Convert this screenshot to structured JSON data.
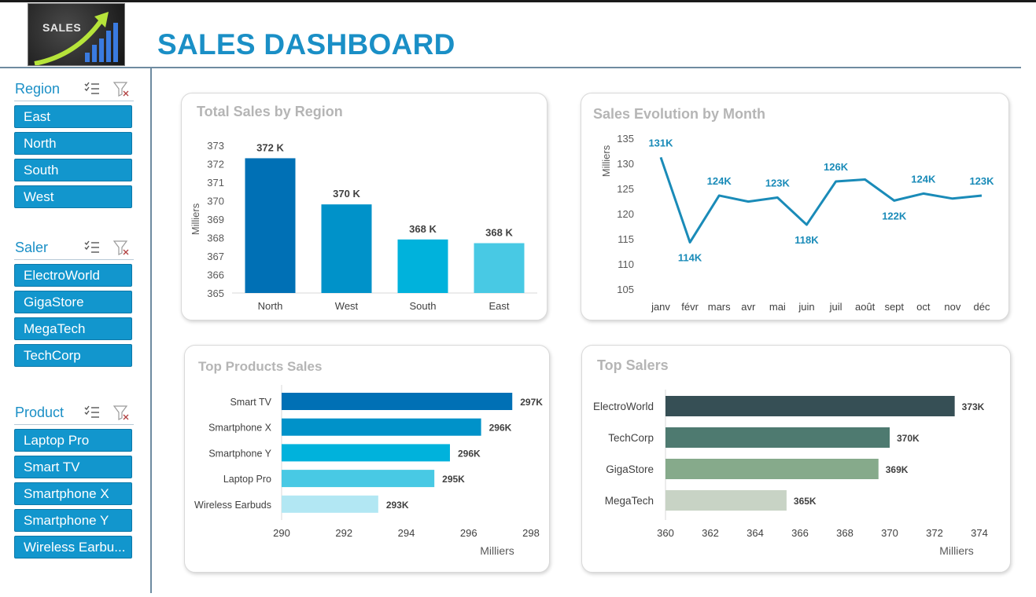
{
  "header": {
    "logo_text": "SALES",
    "title": "SALES DASHBOARD"
  },
  "slicers": {
    "region": {
      "title": "Region",
      "items": [
        "East",
        "North",
        "South",
        "West"
      ]
    },
    "saler": {
      "title": "Saler",
      "items": [
        "ElectroWorld",
        "GigaStore",
        "MegaTech",
        "TechCorp"
      ]
    },
    "product": {
      "title": "Product",
      "items": [
        "Laptop Pro",
        "Smart TV",
        "Smartphone X",
        "Smartphone Y",
        "Wireless Earbu..."
      ]
    }
  },
  "icons": {
    "multiselect": "multi-select-icon",
    "clear_filter": "clear-filter-icon"
  },
  "colors": {
    "accent": "#1a8fc6",
    "slicer_item": "#1296cd",
    "region_bars": [
      "#0070b5",
      "#0092c9",
      "#00b2dc",
      "#48c9e4"
    ],
    "line": "#1a8bb8",
    "product_bars": [
      "#0070b5",
      "#0092c9",
      "#00b2dc",
      "#48c9e4",
      "#b2e7f3"
    ],
    "saler_bars": [
      "#364f55",
      "#4e7a70",
      "#86aa8b",
      "#c8d3c5"
    ]
  },
  "chart_data": [
    {
      "id": "region",
      "type": "bar",
      "title": "Total Sales by Region",
      "ylabel": "Milliers",
      "categories": [
        "North",
        "West",
        "South",
        "East"
      ],
      "values": [
        372.3,
        369.8,
        367.9,
        367.7
      ],
      "data_labels": [
        "372 K",
        "370 K",
        "368 K",
        "368 K"
      ],
      "yticks": [
        365,
        366,
        367,
        368,
        369,
        370,
        371,
        372,
        373
      ],
      "ylim": [
        365,
        373
      ],
      "grid": false
    },
    {
      "id": "month",
      "type": "line",
      "title": "Sales Evolution by Month",
      "ylabel": "Milliers",
      "categories": [
        "janv",
        "févr",
        "mars",
        "avr",
        "mai",
        "juin",
        "juil",
        "août",
        "sept",
        "oct",
        "nov",
        "déc"
      ],
      "values": [
        131.2,
        114.3,
        123.6,
        122.4,
        123.2,
        117.8,
        126.4,
        126.8,
        122.6,
        124.0,
        123.0,
        123.6
      ],
      "data_labels": [
        "131K",
        "114K",
        "124K",
        "",
        "123K",
        "118K",
        "126K",
        "",
        "122K",
        "124K",
        "",
        "123K"
      ],
      "yticks": [
        105,
        110,
        115,
        120,
        125,
        130,
        135
      ],
      "ylim": [
        105,
        135
      ],
      "grid": false
    },
    {
      "id": "products",
      "type": "bar",
      "orientation": "horizontal",
      "title": "Top Products Sales",
      "xlabel": "Milliers",
      "categories": [
        "Smart TV",
        "Smartphone X",
        "Smartphone Y",
        "Laptop Pro",
        "Wireless Earbuds"
      ],
      "values": [
        297.4,
        296.4,
        295.4,
        294.9,
        293.1
      ],
      "data_labels": [
        "297K",
        "296K",
        "296K",
        "295K",
        "293K"
      ],
      "xticks": [
        290,
        292,
        294,
        296,
        298
      ],
      "xlim": [
        290,
        298
      ],
      "grid": false
    },
    {
      "id": "salers",
      "type": "bar",
      "orientation": "horizontal",
      "title": "Top Salers",
      "xlabel": "Milliers",
      "categories": [
        "ElectroWorld",
        "TechCorp",
        "GigaStore",
        "MegaTech"
      ],
      "values": [
        372.9,
        370.0,
        369.5,
        365.4
      ],
      "data_labels": [
        "373K",
        "370K",
        "369K",
        "365K"
      ],
      "xticks": [
        360,
        362,
        364,
        366,
        368,
        370,
        372,
        374
      ],
      "xlim": [
        360,
        374
      ],
      "grid": false
    }
  ]
}
